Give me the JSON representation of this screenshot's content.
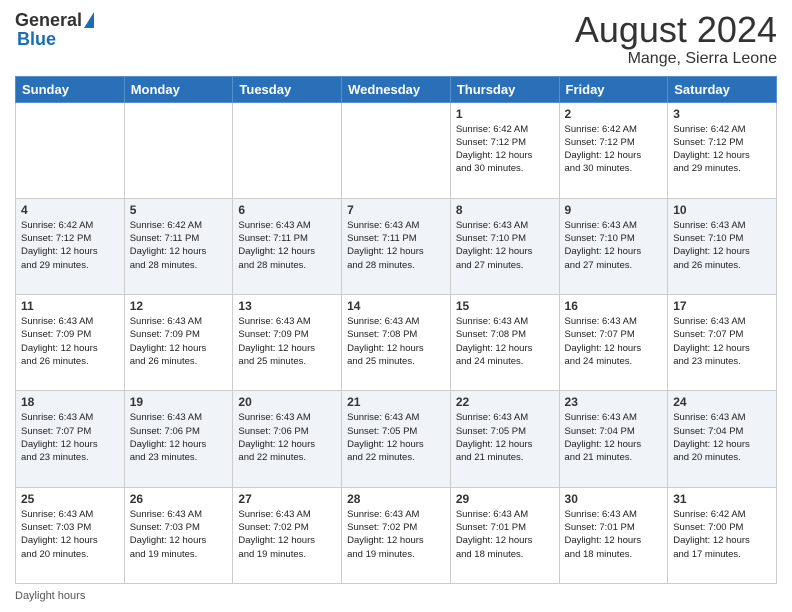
{
  "logo": {
    "general": "General",
    "blue": "Blue"
  },
  "title": "August 2024",
  "subtitle": "Mange, Sierra Leone",
  "days_of_week": [
    "Sunday",
    "Monday",
    "Tuesday",
    "Wednesday",
    "Thursday",
    "Friday",
    "Saturday"
  ],
  "footer_label": "Daylight hours",
  "weeks": [
    [
      {
        "day": "",
        "info": ""
      },
      {
        "day": "",
        "info": ""
      },
      {
        "day": "",
        "info": ""
      },
      {
        "day": "",
        "info": ""
      },
      {
        "day": "1",
        "info": "Sunrise: 6:42 AM\nSunset: 7:12 PM\nDaylight: 12 hours\nand 30 minutes."
      },
      {
        "day": "2",
        "info": "Sunrise: 6:42 AM\nSunset: 7:12 PM\nDaylight: 12 hours\nand 30 minutes."
      },
      {
        "day": "3",
        "info": "Sunrise: 6:42 AM\nSunset: 7:12 PM\nDaylight: 12 hours\nand 29 minutes."
      }
    ],
    [
      {
        "day": "4",
        "info": "Sunrise: 6:42 AM\nSunset: 7:12 PM\nDaylight: 12 hours\nand 29 minutes."
      },
      {
        "day": "5",
        "info": "Sunrise: 6:42 AM\nSunset: 7:11 PM\nDaylight: 12 hours\nand 28 minutes."
      },
      {
        "day": "6",
        "info": "Sunrise: 6:43 AM\nSunset: 7:11 PM\nDaylight: 12 hours\nand 28 minutes."
      },
      {
        "day": "7",
        "info": "Sunrise: 6:43 AM\nSunset: 7:11 PM\nDaylight: 12 hours\nand 28 minutes."
      },
      {
        "day": "8",
        "info": "Sunrise: 6:43 AM\nSunset: 7:10 PM\nDaylight: 12 hours\nand 27 minutes."
      },
      {
        "day": "9",
        "info": "Sunrise: 6:43 AM\nSunset: 7:10 PM\nDaylight: 12 hours\nand 27 minutes."
      },
      {
        "day": "10",
        "info": "Sunrise: 6:43 AM\nSunset: 7:10 PM\nDaylight: 12 hours\nand 26 minutes."
      }
    ],
    [
      {
        "day": "11",
        "info": "Sunrise: 6:43 AM\nSunset: 7:09 PM\nDaylight: 12 hours\nand 26 minutes."
      },
      {
        "day": "12",
        "info": "Sunrise: 6:43 AM\nSunset: 7:09 PM\nDaylight: 12 hours\nand 26 minutes."
      },
      {
        "day": "13",
        "info": "Sunrise: 6:43 AM\nSunset: 7:09 PM\nDaylight: 12 hours\nand 25 minutes."
      },
      {
        "day": "14",
        "info": "Sunrise: 6:43 AM\nSunset: 7:08 PM\nDaylight: 12 hours\nand 25 minutes."
      },
      {
        "day": "15",
        "info": "Sunrise: 6:43 AM\nSunset: 7:08 PM\nDaylight: 12 hours\nand 24 minutes."
      },
      {
        "day": "16",
        "info": "Sunrise: 6:43 AM\nSunset: 7:07 PM\nDaylight: 12 hours\nand 24 minutes."
      },
      {
        "day": "17",
        "info": "Sunrise: 6:43 AM\nSunset: 7:07 PM\nDaylight: 12 hours\nand 23 minutes."
      }
    ],
    [
      {
        "day": "18",
        "info": "Sunrise: 6:43 AM\nSunset: 7:07 PM\nDaylight: 12 hours\nand 23 minutes."
      },
      {
        "day": "19",
        "info": "Sunrise: 6:43 AM\nSunset: 7:06 PM\nDaylight: 12 hours\nand 23 minutes."
      },
      {
        "day": "20",
        "info": "Sunrise: 6:43 AM\nSunset: 7:06 PM\nDaylight: 12 hours\nand 22 minutes."
      },
      {
        "day": "21",
        "info": "Sunrise: 6:43 AM\nSunset: 7:05 PM\nDaylight: 12 hours\nand 22 minutes."
      },
      {
        "day": "22",
        "info": "Sunrise: 6:43 AM\nSunset: 7:05 PM\nDaylight: 12 hours\nand 21 minutes."
      },
      {
        "day": "23",
        "info": "Sunrise: 6:43 AM\nSunset: 7:04 PM\nDaylight: 12 hours\nand 21 minutes."
      },
      {
        "day": "24",
        "info": "Sunrise: 6:43 AM\nSunset: 7:04 PM\nDaylight: 12 hours\nand 20 minutes."
      }
    ],
    [
      {
        "day": "25",
        "info": "Sunrise: 6:43 AM\nSunset: 7:03 PM\nDaylight: 12 hours\nand 20 minutes."
      },
      {
        "day": "26",
        "info": "Sunrise: 6:43 AM\nSunset: 7:03 PM\nDaylight: 12 hours\nand 19 minutes."
      },
      {
        "day": "27",
        "info": "Sunrise: 6:43 AM\nSunset: 7:02 PM\nDaylight: 12 hours\nand 19 minutes."
      },
      {
        "day": "28",
        "info": "Sunrise: 6:43 AM\nSunset: 7:02 PM\nDaylight: 12 hours\nand 19 minutes."
      },
      {
        "day": "29",
        "info": "Sunrise: 6:43 AM\nSunset: 7:01 PM\nDaylight: 12 hours\nand 18 minutes."
      },
      {
        "day": "30",
        "info": "Sunrise: 6:43 AM\nSunset: 7:01 PM\nDaylight: 12 hours\nand 18 minutes."
      },
      {
        "day": "31",
        "info": "Sunrise: 6:42 AM\nSunset: 7:00 PM\nDaylight: 12 hours\nand 17 minutes."
      }
    ]
  ]
}
